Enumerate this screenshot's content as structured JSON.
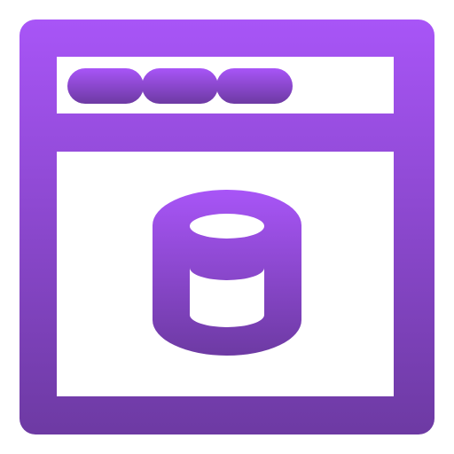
{
  "icon": {
    "name": "browser-window-database-icon",
    "gradient_top": "#a855f7",
    "gradient_bottom": "#6d3aa3",
    "background": "#ffffff"
  }
}
